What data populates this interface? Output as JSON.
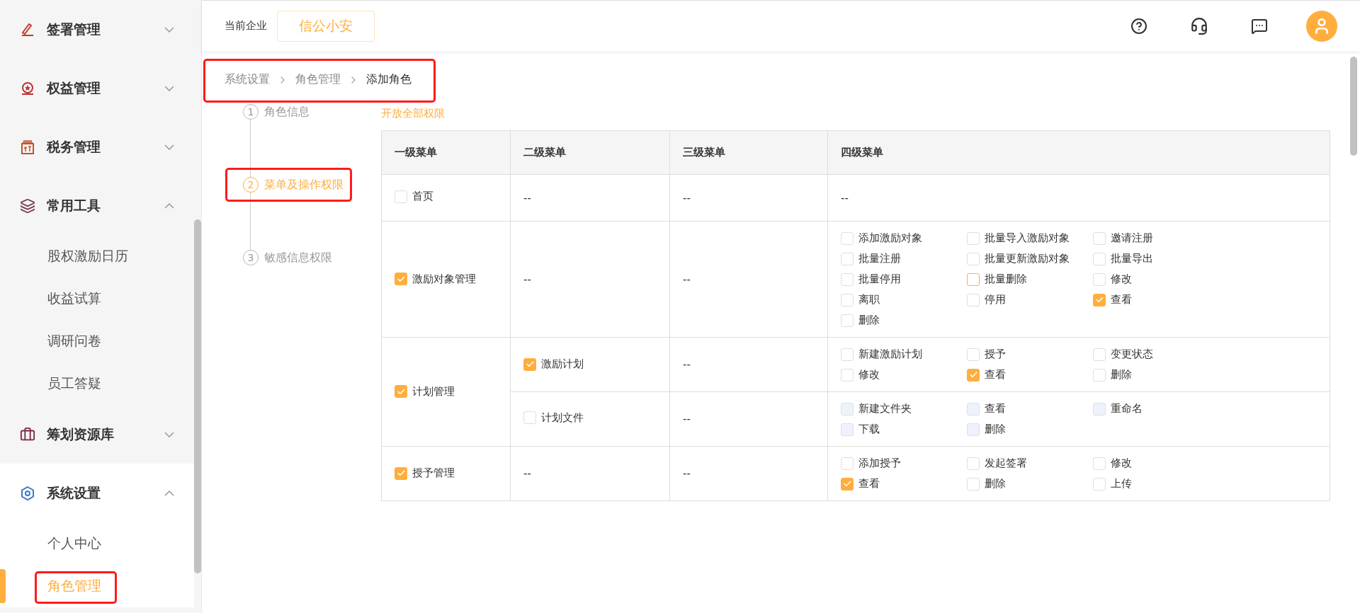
{
  "sidebar": {
    "groups": [
      {
        "label": "签署管理",
        "expanded": false
      },
      {
        "label": "权益管理",
        "expanded": false
      },
      {
        "label": "税务管理",
        "expanded": false
      },
      {
        "label": "常用工具",
        "expanded": true,
        "children": [
          {
            "label": "股权激励日历",
            "selected": false
          },
          {
            "label": "收益试算",
            "selected": false
          },
          {
            "label": "调研问卷",
            "selected": false
          },
          {
            "label": "员工答疑",
            "selected": false
          }
        ]
      },
      {
        "label": "筹划资源库",
        "expanded": false
      },
      {
        "label": "系统设置",
        "expanded": true,
        "children": [
          {
            "label": "个人中心",
            "selected": false,
            "highlighted": false
          },
          {
            "label": "角色管理",
            "selected": true,
            "highlighted": true
          }
        ]
      }
    ]
  },
  "header": {
    "company_label": "当前企业",
    "company": "信公小安"
  },
  "breadcrumb": {
    "highlighted": true,
    "items": [
      "系统设置",
      "角色管理",
      "添加角色"
    ]
  },
  "steps": [
    {
      "number": "1",
      "label": "角色信息",
      "selected": false,
      "highlighted": false
    },
    {
      "number": "2",
      "label": "菜单及操作权限",
      "selected": true,
      "highlighted": true
    },
    {
      "number": "3",
      "label": "敏感信息权限",
      "selected": false,
      "highlighted": false
    }
  ],
  "open_all_link": "开放全部权限",
  "table": {
    "columns": [
      "一级菜单",
      "二级菜单",
      "三级菜单",
      "四级菜单"
    ],
    "rows": [
      {
        "label": "首页",
        "checked": false,
        "subrows": [
          {
            "level2": {
              "kind": "text",
              "text": "--"
            },
            "level3": "--",
            "level4": {
              "kind": "text",
              "text": "--"
            }
          }
        ]
      },
      {
        "label": "激励对象管理",
        "checked": true,
        "subrows": [
          {
            "level2": {
              "kind": "text",
              "text": "--"
            },
            "level3": "--",
            "level4": {
              "kind": "checks",
              "items": [
                {
                  "label": "添加激励对象",
                  "checked": false,
                  "disabled": false
                },
                {
                  "label": "批量导入激励对象",
                  "checked": false,
                  "disabled": false
                },
                {
                  "label": "邀请注册",
                  "checked": false,
                  "disabled": false
                },
                {
                  "label": "批量注册",
                  "checked": false,
                  "disabled": false
                },
                {
                  "label": "批量更新激励对象",
                  "checked": false,
                  "disabled": false
                },
                {
                  "label": "批量导出",
                  "checked": false,
                  "disabled": false
                },
                {
                  "label": "批量停用",
                  "checked": false,
                  "disabled": false
                },
                {
                  "label": "批量删除",
                  "checked": false,
                  "disabled": false,
                  "focused": true
                },
                {
                  "label": "修改",
                  "checked": false,
                  "disabled": false
                },
                {
                  "label": "离职",
                  "checked": false,
                  "disabled": false
                },
                {
                  "label": "停用",
                  "checked": false,
                  "disabled": false
                },
                {
                  "label": "查看",
                  "checked": true,
                  "disabled": false
                },
                {
                  "label": "删除",
                  "checked": false,
                  "disabled": false
                }
              ]
            }
          }
        ]
      },
      {
        "label": "计划管理",
        "checked": true,
        "subrows": [
          {
            "level2": {
              "kind": "checkbox",
              "label": "激励计划",
              "checked": true
            },
            "level3": "--",
            "level4": {
              "kind": "checks",
              "items": [
                {
                  "label": "新建激励计划",
                  "checked": false,
                  "disabled": false
                },
                {
                  "label": "授予",
                  "checked": false,
                  "disabled": false
                },
                {
                  "label": "变更状态",
                  "checked": false,
                  "disabled": false
                },
                {
                  "label": "修改",
                  "checked": false,
                  "disabled": false
                },
                {
                  "label": "查看",
                  "checked": true,
                  "disabled": false
                },
                {
                  "label": "删除",
                  "checked": false,
                  "disabled": false
                }
              ]
            }
          },
          {
            "level2": {
              "kind": "checkbox",
              "label": "计划文件",
              "checked": false
            },
            "level3": "--",
            "level4": {
              "kind": "checks",
              "items": [
                {
                  "label": "新建文件夹",
                  "checked": false,
                  "disabled": true
                },
                {
                  "label": "查看",
                  "checked": false,
                  "disabled": true
                },
                {
                  "label": "重命名",
                  "checked": false,
                  "disabled": true
                },
                {
                  "label": "下载",
                  "checked": false,
                  "disabled": true
                },
                {
                  "label": "删除",
                  "checked": false,
                  "disabled": true
                }
              ]
            }
          }
        ]
      },
      {
        "label": "授予管理",
        "checked": true,
        "subrows": [
          {
            "level2": {
              "kind": "text",
              "text": "--"
            },
            "level3": "--",
            "level4": {
              "kind": "checks",
              "items": [
                {
                  "label": "添加授予",
                  "checked": false,
                  "disabled": false
                },
                {
                  "label": "发起签署",
                  "checked": false,
                  "disabled": false
                },
                {
                  "label": "修改",
                  "checked": false,
                  "disabled": false
                },
                {
                  "label": "查看",
                  "checked": true,
                  "disabled": false
                },
                {
                  "label": "删除",
                  "checked": false,
                  "disabled": false
                },
                {
                  "label": "上传",
                  "checked": false,
                  "disabled": false
                }
              ]
            }
          }
        ]
      }
    ]
  }
}
